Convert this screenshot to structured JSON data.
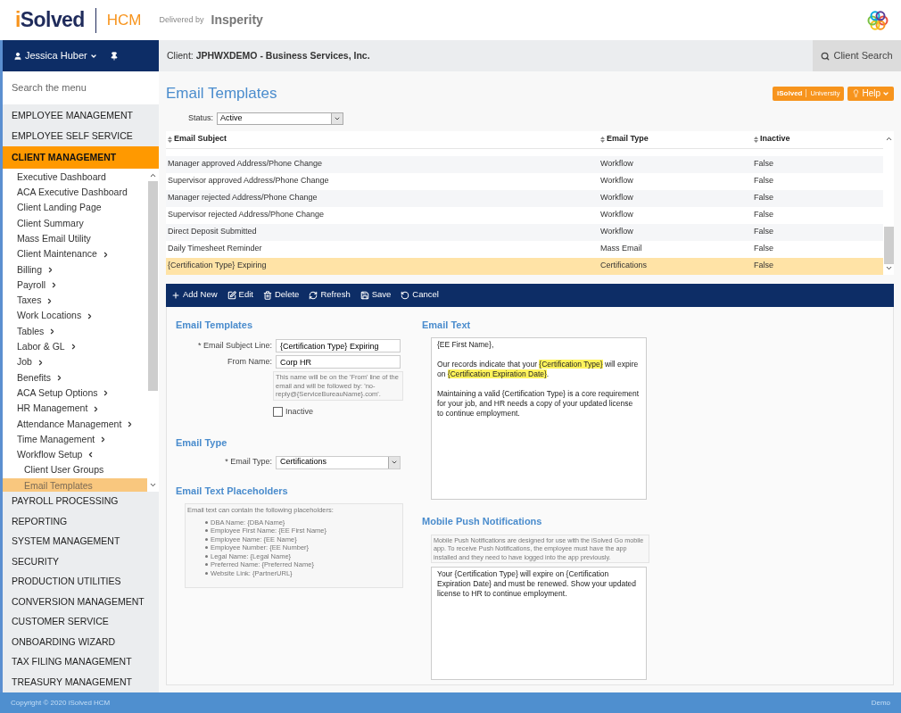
{
  "header": {
    "logo": {
      "brand_i": "i",
      "brand_rest": "Solved",
      "product": "HCM",
      "delivered_by": "Delivered by",
      "partner": "Insperity"
    }
  },
  "user_bar": {
    "user_name": "Jessica Huber"
  },
  "client_bar": {
    "client": "Client: **JPHWXDEMO - Business Services, Inc.**",
    "search_button": "Client Search"
  },
  "sidebar": {
    "search": {
      "placeholder": "Search the menu"
    },
    "sections": [
      {
        "label": "EMPLOYEE MANAGEMENT",
        "selected": false
      },
      {
        "label": "EMPLOYEE SELF SERVICE",
        "selected": false
      },
      {
        "label": "CLIENT MANAGEMENT",
        "selected": true,
        "children": [
          {
            "label": "Executive Dashboard",
            "kind": "link",
            "selected": false
          },
          {
            "label": "ACA Executive Dashboard",
            "kind": "link",
            "selected": false
          },
          {
            "label": "Client Landing Page",
            "kind": "link",
            "selected": false
          },
          {
            "label": "Client Summary",
            "kind": "link",
            "selected": false
          },
          {
            "label": "Mass Email Utility",
            "kind": "link",
            "selected": false
          },
          {
            "label": "Client Maintenance",
            "kind": "folder",
            "expanded": false,
            "selected": false
          },
          {
            "label": "Billing",
            "kind": "folder",
            "expanded": false,
            "selected": false
          },
          {
            "label": "Payroll",
            "kind": "folder",
            "expanded": false,
            "selected": false
          },
          {
            "label": "Taxes",
            "kind": "folder",
            "expanded": false,
            "selected": false
          },
          {
            "label": "Work Locations",
            "kind": "folder",
            "expanded": false,
            "selected": false
          },
          {
            "label": "Tables",
            "kind": "folder",
            "expanded": false,
            "selected": false
          },
          {
            "label": "Labor & GL",
            "kind": "folder",
            "expanded": false,
            "selected": false
          },
          {
            "label": "Job",
            "kind": "folder",
            "expanded": false,
            "selected": false
          },
          {
            "label": "Benefits",
            "kind": "folder",
            "expanded": false,
            "selected": false
          },
          {
            "label": "ACA Setup Options",
            "kind": "folder",
            "expanded": false,
            "selected": false
          },
          {
            "label": "HR Management",
            "kind": "folder",
            "expanded": false,
            "selected": false
          },
          {
            "label": "Attendance Management",
            "kind": "folder",
            "expanded": false,
            "selected": false
          },
          {
            "label": "Time Management",
            "kind": "folder",
            "expanded": false,
            "selected": false
          },
          {
            "label": "Workflow Setup",
            "kind": "folder",
            "expanded": true,
            "selected": false,
            "children": [
              {
                "label": "Client User Groups",
                "selected": false
              },
              {
                "label": "Email Templates",
                "selected": true
              }
            ]
          }
        ]
      },
      {
        "label": "PAYROLL PROCESSING",
        "selected": false
      },
      {
        "label": "REPORTING",
        "selected": false
      },
      {
        "label": "SYSTEM MANAGEMENT",
        "selected": false
      },
      {
        "label": "SECURITY",
        "selected": false
      },
      {
        "label": "PRODUCTION UTILITIES",
        "selected": false
      },
      {
        "label": "CONVERSION MANAGEMENT",
        "selected": false
      },
      {
        "label": "CUSTOMER SERVICE",
        "selected": false
      },
      {
        "label": "ONBOARDING WIZARD",
        "selected": false
      },
      {
        "label": "TAX FILING MANAGEMENT",
        "selected": false
      },
      {
        "label": "TREASURY MANAGEMENT",
        "selected": false
      }
    ]
  },
  "page": {
    "title": "Email Templates",
    "university_button": {
      "brand": "iSolved",
      "label": "University"
    },
    "help_button": "Help",
    "status_filter": {
      "label": "Status:",
      "value": "Active"
    }
  },
  "table": {
    "columns": [
      "Email Subject",
      "Email Type",
      "Inactive"
    ],
    "rows": [
      {
        "cells": [
          "Manager approved Address/Phone Change",
          "Workflow",
          "False"
        ],
        "selected": false
      },
      {
        "cells": [
          "Supervisor approved Address/Phone Change",
          "Workflow",
          "False"
        ],
        "selected": false
      },
      {
        "cells": [
          "Manager rejected Address/Phone Change",
          "Workflow",
          "False"
        ],
        "selected": false
      },
      {
        "cells": [
          "Supervisor rejected Address/Phone Change",
          "Workflow",
          "False"
        ],
        "selected": false
      },
      {
        "cells": [
          "Direct Deposit Submitted",
          "Workflow",
          "False"
        ],
        "selected": false
      },
      {
        "cells": [
          "Daily Timesheet Reminder",
          "Mass Email",
          "False"
        ],
        "selected": false
      },
      {
        "cells": [
          "{Certification Type} Expiring",
          "Certifications",
          "False"
        ],
        "selected": true
      }
    ]
  },
  "toolbar": [
    {
      "kind": "add",
      "label": "Add New"
    },
    {
      "kind": "edit",
      "label": "Edit"
    },
    {
      "kind": "delete",
      "label": "Delete"
    },
    {
      "kind": "refresh",
      "label": "Refresh"
    },
    {
      "kind": "save",
      "label": "Save"
    },
    {
      "kind": "cancel",
      "label": "Cancel"
    }
  ],
  "form": {
    "templates_section": {
      "title": "Email Templates",
      "subject_line": {
        "label": "* Email Subject Line:",
        "value": "{Certification Type} Expiring"
      },
      "from_name": {
        "label": "From Name:",
        "value": "Corp HR"
      },
      "from_note": "This name will be on the 'From' line of the email and will be followed by: 'no-reply@{ServiceBureauName}.com'.",
      "inactive": {
        "label": "Inactive",
        "checked": false
      }
    },
    "type_section": {
      "title": "Email Type",
      "email_type": {
        "label": "* Email Type:",
        "value": "Certifications"
      }
    },
    "placeholders_section": {
      "title": "Email Text Placeholders",
      "intro": "Email text can contain the following placeholders:",
      "items": [
        "DBA Name: {DBA Name}",
        "Employee First Name: {EE First Name}",
        "Employee Name: {EE Name}",
        "Employee Number: {EE Number}",
        "Legal Name: {Legal Name}",
        "Preferred Name: {Preferred Name}",
        "Website Link: {PartnerURL}"
      ]
    },
    "email_text_section": {
      "title": "Email Text",
      "paragraphs": [
        [
          {
            "text": "{EE First Name},",
            "highlighted": false
          }
        ],
        [
          {
            "text": "Our records indicate that your ",
            "highlighted": false
          },
          {
            "text": "{Certification Type}",
            "highlighted": true
          },
          {
            "text": " will expire on ",
            "highlighted": false
          },
          {
            "text": "{Certification Expiration Date}",
            "highlighted": true
          },
          {
            "text": ".",
            "highlighted": false
          }
        ],
        [
          {
            "text": "Maintaining a valid {Certification Type} is a core requirement for your job, and HR needs a copy of your updated license to continue employment.",
            "highlighted": false
          }
        ]
      ]
    },
    "push_section": {
      "title": "Mobile Push Notifications",
      "note": "Mobile Push Notifications are designed for use with the iSolved Go mobile app. To receive Push Notifications, the employee must have the app installed and they need to have logged into the app previously.",
      "message": "Your {Certification Type} will expire on {Certification Expiration Date} and must be renewed. Show your updated license to HR to continue employment."
    }
  },
  "footer": {
    "copyright": "Copyright © 2020 iSolved HCM",
    "environment": "Demo"
  }
}
